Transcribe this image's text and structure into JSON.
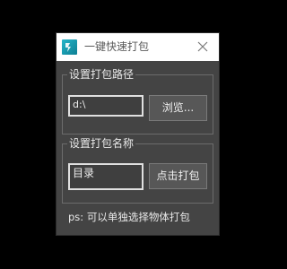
{
  "window": {
    "title": "一键快速打包",
    "icon": "3dsmax-app-icon",
    "close_icon": "close-icon"
  },
  "path_group": {
    "label": "设置打包路径",
    "path_value": "d:\\",
    "browse_label": "浏览..."
  },
  "name_group": {
    "label": "设置打包名称",
    "name_value": "目录",
    "pack_label": "点击打包"
  },
  "hint": "ps: 可以单独选择物体打包",
  "colors": {
    "background": "#000000",
    "panel": "#444444",
    "titlebar": "#ffffff",
    "accent": "#1a9fb4"
  }
}
